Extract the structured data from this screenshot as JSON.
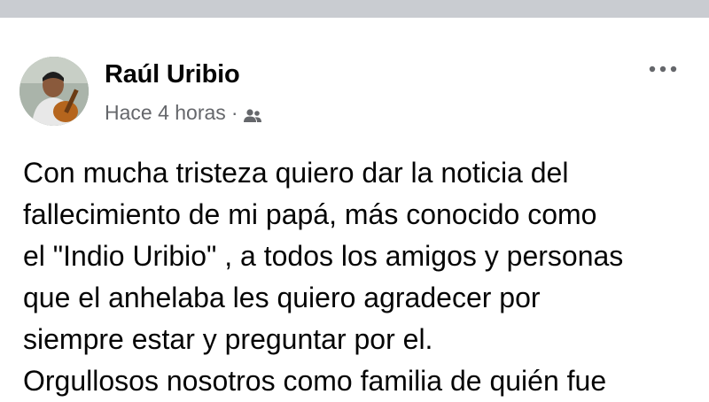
{
  "post": {
    "author_name": "Raúl Uribio",
    "timestamp": "Hace 4 horas",
    "separator": "·",
    "audience_icon": "friends-icon",
    "menu_icon": "more-options-icon",
    "text_lines": [
      "Con mucha tristeza quiero dar la noticia del",
      "fallecimiento de mi papá, más conocido como",
      "el \"Indio Uribio\" , a todos los amigos y personas",
      "que el anhelaba les quiero agradecer por",
      "siempre estar y preguntar por el.",
      "Orgullosos nosotros como familia de quién fue"
    ]
  },
  "colors": {
    "divider": "#c9ccd1",
    "text_primary": "#050505",
    "text_secondary": "#65676b"
  }
}
